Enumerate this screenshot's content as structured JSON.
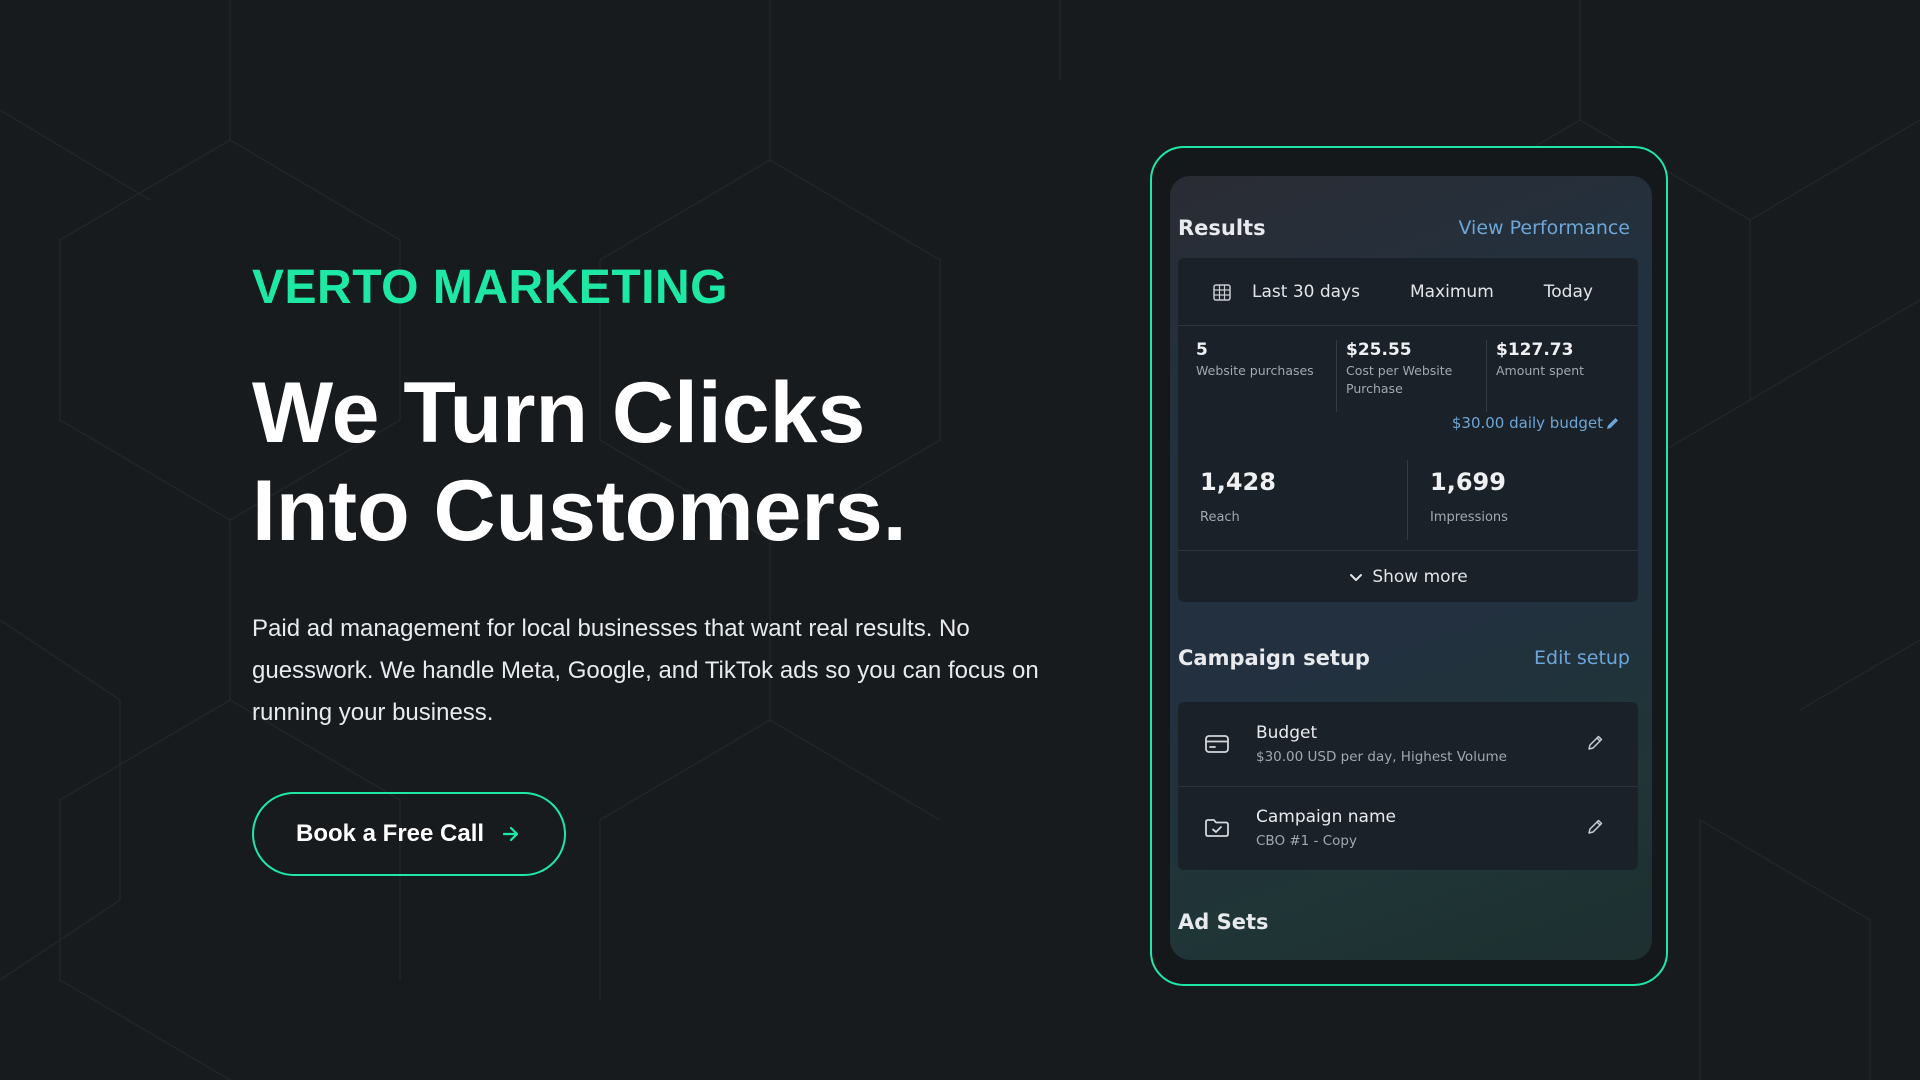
{
  "hero": {
    "brand": "VERTO MARKETING",
    "headline_line1": "We Turn Clicks",
    "headline_line2": "Into Customers.",
    "description": "Paid ad management for local businesses that want real results. No guesswork. We handle Meta, Google, and TikTok ads so you can focus on running your business.",
    "cta_label": "Book a Free Call",
    "cta_icon": "arrow-right-icon"
  },
  "colors": {
    "accent": "#1de9a4",
    "background": "#181b1e",
    "link": "#6da6d8"
  },
  "preview": {
    "results": {
      "title": "Results",
      "link": "View Performance",
      "filters": [
        "Last 30 days",
        "Maximum",
        "Today"
      ],
      "metrics": [
        {
          "value": "5",
          "label": "Website purchases"
        },
        {
          "value": "$25.55",
          "label": "Cost per Website Purchase"
        },
        {
          "value": "$127.73",
          "label": "Amount spent"
        }
      ],
      "budget_link": "$30.00 daily budget",
      "reach": {
        "value": "1,428",
        "label": "Reach"
      },
      "impressions": {
        "value": "1,699",
        "label": "Impressions"
      },
      "show_more": "Show more"
    },
    "setup": {
      "title": "Campaign setup",
      "link": "Edit setup",
      "items": [
        {
          "title": "Budget",
          "subtitle": "$30.00 USD per day, Highest Volume",
          "icon": "credit-card-icon"
        },
        {
          "title": "Campaign name",
          "subtitle": "CBO #1 - Copy",
          "icon": "folder-check-icon"
        }
      ]
    },
    "adsets_title": "Ad Sets"
  }
}
